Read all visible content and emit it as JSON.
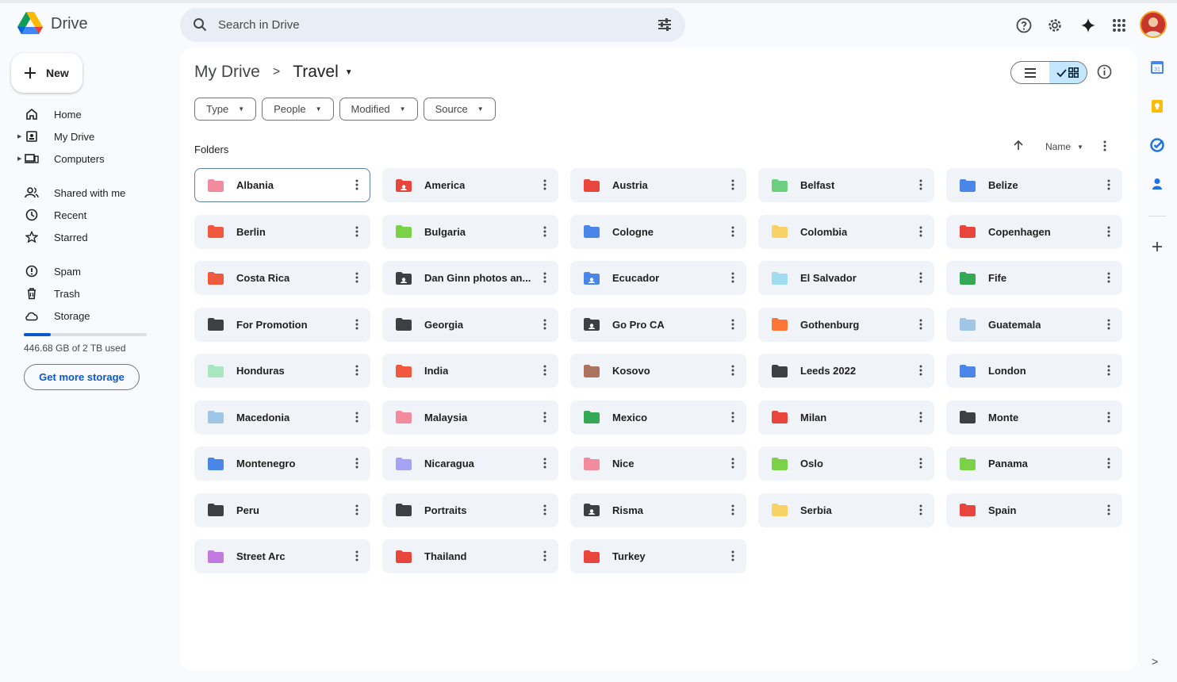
{
  "app": {
    "name": "Drive"
  },
  "search": {
    "placeholder": "Search in Drive"
  },
  "sidebar": {
    "new_label": "New",
    "items": [
      {
        "label": "Home",
        "icon": "home-icon"
      },
      {
        "label": "My Drive",
        "icon": "my-drive-icon"
      },
      {
        "label": "Computers",
        "icon": "computers-icon"
      },
      {
        "label": "Shared with me",
        "icon": "shared-icon"
      },
      {
        "label": "Recent",
        "icon": "recent-icon"
      },
      {
        "label": "Starred",
        "icon": "star-icon"
      },
      {
        "label": "Spam",
        "icon": "spam-icon"
      },
      {
        "label": "Trash",
        "icon": "trash-icon"
      },
      {
        "label": "Storage",
        "icon": "cloud-icon"
      }
    ],
    "storage": {
      "used_text": "446.68 GB of 2 TB used",
      "fraction_used": 0.22,
      "button_label": "Get more storage"
    }
  },
  "breadcrumb": {
    "root": "My Drive",
    "current": "Travel"
  },
  "filters": [
    "Type",
    "People",
    "Modified",
    "Source"
  ],
  "section_title": "Folders",
  "sort": {
    "label": "Name"
  },
  "folders": [
    {
      "name": "Albania",
      "color": "#f28b9e",
      "shared": false,
      "selected": true
    },
    {
      "name": "America",
      "color": "#e8453c",
      "shared": true
    },
    {
      "name": "Austria",
      "color": "#e8453c",
      "shared": false
    },
    {
      "name": "Belfast",
      "color": "#6ccf7f",
      "shared": false
    },
    {
      "name": "Belize",
      "color": "#4a86e8",
      "shared": false
    },
    {
      "name": "Berlin",
      "color": "#f0593e",
      "shared": false
    },
    {
      "name": "Bulgaria",
      "color": "#7bd148",
      "shared": false
    },
    {
      "name": "Cologne",
      "color": "#4a86e8",
      "shared": false
    },
    {
      "name": "Colombia",
      "color": "#fad165",
      "shared": false
    },
    {
      "name": "Copenhagen",
      "color": "#e8453c",
      "shared": false
    },
    {
      "name": "Costa Rica",
      "color": "#f0593e",
      "shared": false
    },
    {
      "name": "Dan Ginn photos an...",
      "color": "#3c4043",
      "shared": true
    },
    {
      "name": "Ecucador",
      "color": "#4a86e8",
      "shared": true
    },
    {
      "name": "El Salvador",
      "color": "#9fdcf0",
      "shared": false
    },
    {
      "name": "Fife",
      "color": "#34a853",
      "shared": false
    },
    {
      "name": "For Promotion",
      "color": "#3c4043",
      "shared": false
    },
    {
      "name": "Georgia",
      "color": "#3c4043",
      "shared": false
    },
    {
      "name": "Go Pro CA",
      "color": "#3c4043",
      "shared": true
    },
    {
      "name": "Gothenburg",
      "color": "#ff7537",
      "shared": false
    },
    {
      "name": "Guatemala",
      "color": "#9fc6e7",
      "shared": false
    },
    {
      "name": "Honduras",
      "color": "#a8e6c1",
      "shared": false
    },
    {
      "name": "India",
      "color": "#f0593e",
      "shared": false
    },
    {
      "name": "Kosovo",
      "color": "#ac725e",
      "shared": false
    },
    {
      "name": "Leeds 2022",
      "color": "#3c4043",
      "shared": false
    },
    {
      "name": "London",
      "color": "#4a86e8",
      "shared": false
    },
    {
      "name": "Macedonia",
      "color": "#9fc6e7",
      "shared": false
    },
    {
      "name": "Malaysia",
      "color": "#f28b9e",
      "shared": false
    },
    {
      "name": "Mexico",
      "color": "#34a853",
      "shared": false
    },
    {
      "name": "Milan",
      "color": "#e8453c",
      "shared": false
    },
    {
      "name": "Monte",
      "color": "#3c4043",
      "shared": false
    },
    {
      "name": "Montenegro",
      "color": "#4a86e8",
      "shared": false
    },
    {
      "name": "Nicaragua",
      "color": "#a4a3f5",
      "shared": false
    },
    {
      "name": "Nice",
      "color": "#f28b9e",
      "shared": false
    },
    {
      "name": "Oslo",
      "color": "#7bd148",
      "shared": false
    },
    {
      "name": "Panama",
      "color": "#7bd148",
      "shared": false
    },
    {
      "name": "Peru",
      "color": "#3c4043",
      "shared": false
    },
    {
      "name": "Portraits",
      "color": "#3c4043",
      "shared": false
    },
    {
      "name": "Risma",
      "color": "#3c4043",
      "shared": true
    },
    {
      "name": "Serbia",
      "color": "#fad165",
      "shared": false
    },
    {
      "name": "Spain",
      "color": "#e8453c",
      "shared": false
    },
    {
      "name": "Street Arc",
      "color": "#c27ae0",
      "shared": false
    },
    {
      "name": "Thailand",
      "color": "#e8453c",
      "shared": false
    },
    {
      "name": "Turkey",
      "color": "#e8453c",
      "shared": false
    }
  ]
}
